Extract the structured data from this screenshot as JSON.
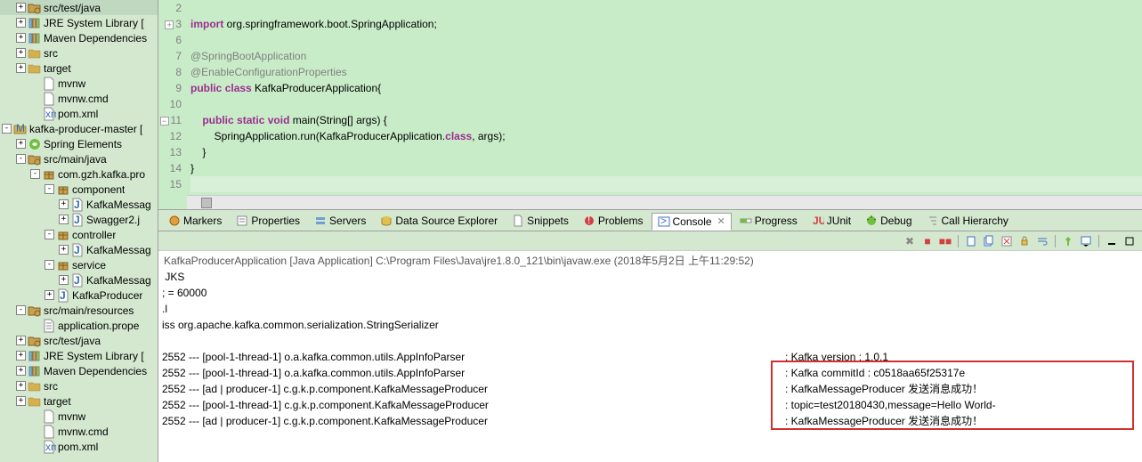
{
  "sidebar": [
    {
      "ind": 1,
      "exp": "+",
      "icon": "src-folder",
      "label": "src/test/java"
    },
    {
      "ind": 1,
      "exp": "+",
      "icon": "library",
      "label": "JRE System Library ["
    },
    {
      "ind": 1,
      "exp": "+",
      "icon": "library",
      "label": "Maven Dependencies"
    },
    {
      "ind": 1,
      "exp": "+",
      "icon": "folder",
      "label": "src"
    },
    {
      "ind": 1,
      "exp": "+",
      "icon": "folder",
      "label": "target"
    },
    {
      "ind": 2,
      "exp": " ",
      "icon": "file",
      "label": "mvnw"
    },
    {
      "ind": 2,
      "exp": " ",
      "icon": "file",
      "label": "mvnw.cmd"
    },
    {
      "ind": 2,
      "exp": " ",
      "icon": "xml",
      "label": "pom.xml"
    },
    {
      "ind": 0,
      "exp": "-",
      "icon": "project",
      "label": "kafka-producer-master ["
    },
    {
      "ind": 1,
      "exp": "+",
      "icon": "spring",
      "label": "Spring Elements"
    },
    {
      "ind": 1,
      "exp": "-",
      "icon": "src-folder",
      "label": "src/main/java"
    },
    {
      "ind": 2,
      "exp": "-",
      "icon": "package",
      "label": "com.gzh.kafka.pro"
    },
    {
      "ind": 3,
      "exp": "-",
      "icon": "package",
      "label": "component"
    },
    {
      "ind": 4,
      "exp": "+",
      "icon": "java",
      "label": "KafkaMessag"
    },
    {
      "ind": 4,
      "exp": "+",
      "icon": "java",
      "label": "Swagger2.j"
    },
    {
      "ind": 3,
      "exp": "-",
      "icon": "package",
      "label": "controller"
    },
    {
      "ind": 4,
      "exp": "+",
      "icon": "java",
      "label": "KafkaMessag"
    },
    {
      "ind": 3,
      "exp": "-",
      "icon": "package",
      "label": "service"
    },
    {
      "ind": 4,
      "exp": "+",
      "icon": "java",
      "label": "KafkaMessag"
    },
    {
      "ind": 3,
      "exp": "+",
      "icon": "java",
      "label": "KafkaProducer"
    },
    {
      "ind": 1,
      "exp": "-",
      "icon": "src-folder",
      "label": "src/main/resources"
    },
    {
      "ind": 2,
      "exp": " ",
      "icon": "props",
      "label": "application.prope"
    },
    {
      "ind": 1,
      "exp": "+",
      "icon": "src-folder",
      "label": "src/test/java"
    },
    {
      "ind": 1,
      "exp": "+",
      "icon": "library",
      "label": "JRE System Library ["
    },
    {
      "ind": 1,
      "exp": "+",
      "icon": "library",
      "label": "Maven Dependencies"
    },
    {
      "ind": 1,
      "exp": "+",
      "icon": "folder",
      "label": "src"
    },
    {
      "ind": 1,
      "exp": "+",
      "icon": "folder",
      "label": "target"
    },
    {
      "ind": 2,
      "exp": " ",
      "icon": "file",
      "label": "mvnw"
    },
    {
      "ind": 2,
      "exp": " ",
      "icon": "file",
      "label": "mvnw.cmd"
    },
    {
      "ind": 2,
      "exp": " ",
      "icon": "xml",
      "label": "pom.xml"
    }
  ],
  "code": {
    "lines": [
      {
        "n": "2",
        "t": ""
      },
      {
        "n": "3",
        "marker": "+",
        "tokens": [
          {
            "c": "kw",
            "t": "import"
          },
          {
            "c": "",
            "t": " org.springframework.boot.SpringApplication;"
          }
        ]
      },
      {
        "n": "6",
        "t": ""
      },
      {
        "n": "7",
        "tokens": [
          {
            "c": "ann",
            "t": "@SpringBootApplication"
          }
        ]
      },
      {
        "n": "8",
        "tokens": [
          {
            "c": "ann",
            "t": "@EnableConfigurationProperties"
          }
        ]
      },
      {
        "n": "9",
        "tokens": [
          {
            "c": "kw",
            "t": "public"
          },
          {
            "c": "",
            "t": " "
          },
          {
            "c": "kw",
            "t": "class"
          },
          {
            "c": "",
            "t": " KafkaProducerApplication{"
          }
        ]
      },
      {
        "n": "10",
        "t": ""
      },
      {
        "n": "11",
        "marker": "-",
        "tokens": [
          {
            "c": "",
            "t": "    "
          },
          {
            "c": "kw",
            "t": "public"
          },
          {
            "c": "",
            "t": " "
          },
          {
            "c": "kw",
            "t": "static"
          },
          {
            "c": "",
            "t": " "
          },
          {
            "c": "kw",
            "t": "void"
          },
          {
            "c": "",
            "t": " main(String[] args) {"
          }
        ]
      },
      {
        "n": "12",
        "tokens": [
          {
            "c": "",
            "t": "        SpringApplication."
          },
          {
            "c": "",
            "t": "run"
          },
          {
            "c": "",
            "t": "(KafkaProducerApplication."
          },
          {
            "c": "kw",
            "t": "class"
          },
          {
            "c": "",
            "t": ", args);"
          }
        ]
      },
      {
        "n": "13",
        "tokens": [
          {
            "c": "",
            "t": "    }"
          }
        ]
      },
      {
        "n": "14",
        "tokens": [
          {
            "c": "",
            "t": "}"
          }
        ]
      },
      {
        "n": "15",
        "t": "",
        "cursor": true
      }
    ]
  },
  "tabs": [
    {
      "icon": "markers",
      "label": "Markers"
    },
    {
      "icon": "props",
      "label": "Properties"
    },
    {
      "icon": "servers",
      "label": "Servers"
    },
    {
      "icon": "db",
      "label": "Data Source Explorer"
    },
    {
      "icon": "snip",
      "label": "Snippets"
    },
    {
      "icon": "prob",
      "label": "Problems"
    },
    {
      "icon": "console",
      "label": "Console",
      "active": true,
      "close": true
    },
    {
      "icon": "progress",
      "label": "Progress"
    },
    {
      "icon": "junit",
      "label": "JUnit"
    },
    {
      "icon": "debug",
      "label": "Debug"
    },
    {
      "icon": "call",
      "label": "Call Hierarchy"
    }
  ],
  "console": {
    "title": "KafkaProducerApplication [Java Application] C:\\Program Files\\Java\\jre1.8.0_121\\bin\\javaw.exe (2018年5月2日 上午11:29:52)",
    "lines": [
      {
        "l": " JKS",
        "r": ""
      },
      {
        "l": "; = 60000",
        "r": ""
      },
      {
        "l": ".l",
        "r": ""
      },
      {
        "l": "iss org.apache.kafka.common.serialization.StringSerializer",
        "r": ""
      },
      {
        "l": "",
        "r": ""
      },
      {
        "l": "2552 --- [pool-1-thread-1] o.a.kafka.common.utils.AppInfoParser       ",
        "r": ": Kafka version : 1.0.1"
      },
      {
        "l": "2552 --- [pool-1-thread-1] o.a.kafka.common.utils.AppInfoParser       ",
        "r": ": Kafka commitId : c0518aa65f25317e"
      },
      {
        "l": "2552 --- [ad | producer-1] c.g.k.p.component.KafkaMessageProducer     ",
        "r": ": KafkaMessageProducer 发送消息成功！"
      },
      {
        "l": "2552 --- [pool-1-thread-1] c.g.k.p.component.KafkaMessageProducer     ",
        "r": ": topic=test20180430,message=Hello World-"
      },
      {
        "l": "2552 --- [ad | producer-1] c.g.k.p.component.KafkaMessageProducer     ",
        "r": ": KafkaMessageProducer 发送消息成功！"
      }
    ]
  },
  "toolbar": [
    "remove-launch",
    "stop",
    "stop-all",
    "",
    "doc",
    "doc-all",
    "clear",
    "scroll-lock",
    "word-wrap",
    "",
    "pin",
    "dropdown",
    "",
    "min",
    "max"
  ]
}
